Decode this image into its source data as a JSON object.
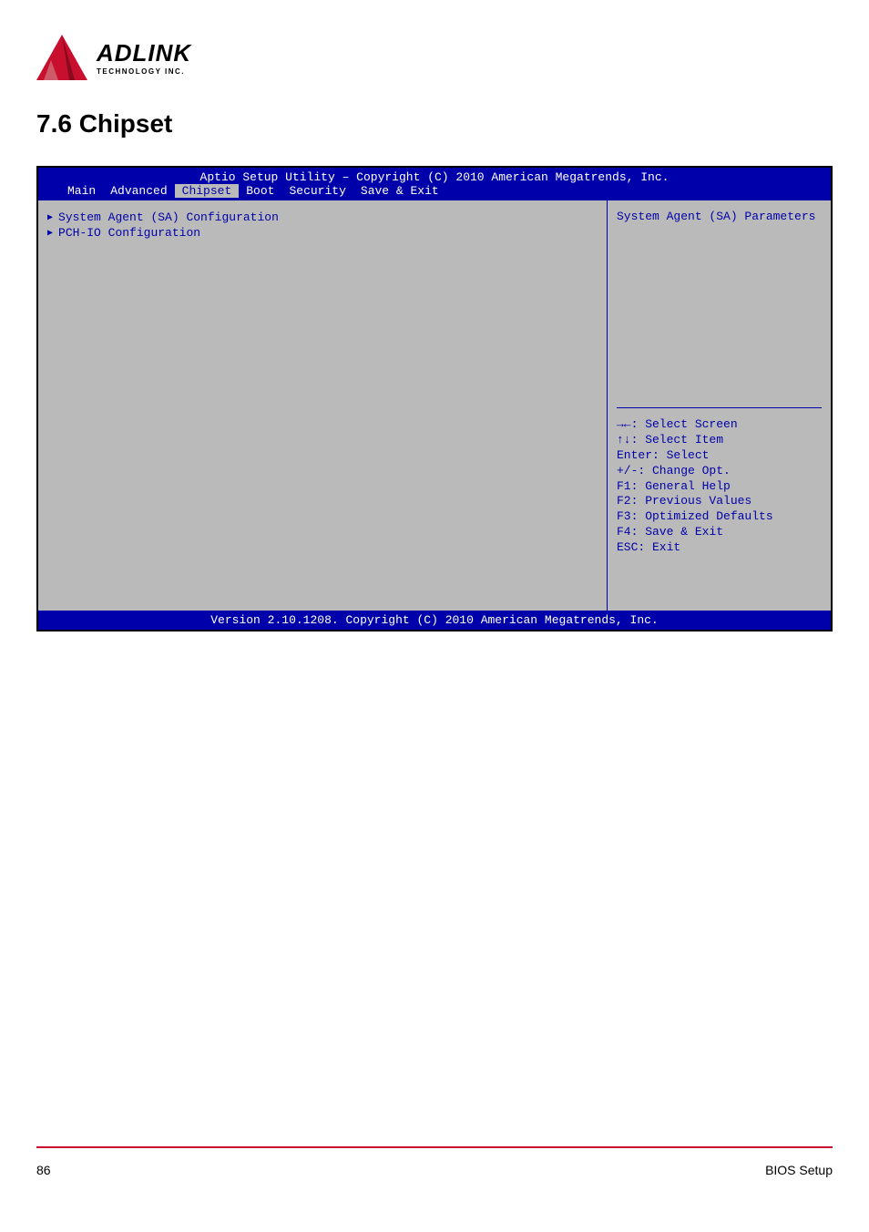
{
  "logo": {
    "main": "ADLINK",
    "sub": "TECHNOLOGY INC."
  },
  "section_title": "7.6 Chipset",
  "bios": {
    "title": "Aptio Setup Utility – Copyright (C) 2010 American Megatrends, Inc.",
    "tabs": [
      "Main",
      "Advanced",
      "Chipset",
      "Boot",
      "Security",
      "Save & Exit"
    ],
    "active_tab": "Chipset",
    "menu_items": [
      "System Agent (SA) Configuration",
      "PCH-IO Configuration"
    ],
    "sidebar_desc": "System Agent (SA) Parameters",
    "help": [
      "→←: Select Screen",
      "↑↓: Select Item",
      "Enter: Select",
      "+/-: Change Opt.",
      "F1: General Help",
      "F2: Previous Values",
      "F3: Optimized Defaults",
      "F4: Save & Exit",
      "ESC: Exit"
    ],
    "footer": "Version 2.10.1208. Copyright (C) 2010 American Megatrends, Inc."
  },
  "page_footer": {
    "left": "86",
    "right": "BIOS Setup"
  }
}
